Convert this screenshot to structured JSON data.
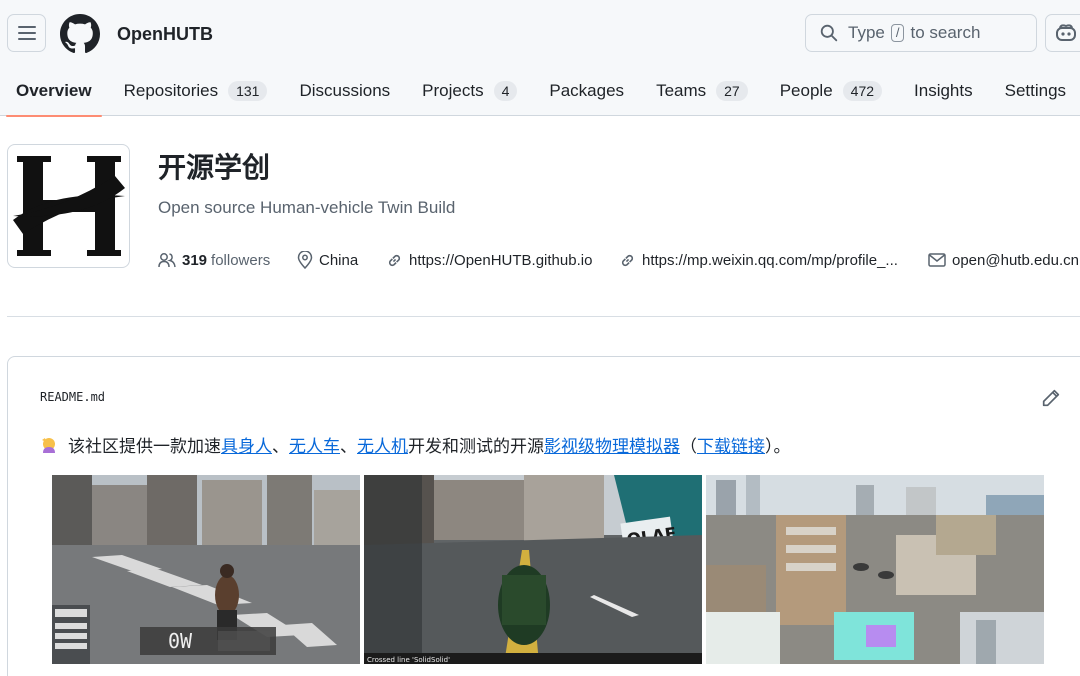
{
  "header": {
    "org_name": "OpenHUTB",
    "search": {
      "before": "Type",
      "key": "/",
      "after": "to search"
    }
  },
  "tabs": [
    {
      "label": "Overview"
    },
    {
      "label": "Repositories",
      "count": "131"
    },
    {
      "label": "Discussions"
    },
    {
      "label": "Projects",
      "count": "4"
    },
    {
      "label": "Packages"
    },
    {
      "label": "Teams",
      "count": "27"
    },
    {
      "label": "People",
      "count": "472"
    },
    {
      "label": "Insights"
    },
    {
      "label": "Settings"
    }
  ],
  "profile": {
    "title": "开源学创",
    "description": "Open source Human-vehicle Twin Build",
    "followers_count": "319",
    "followers_label": "followers",
    "location": "China",
    "website": "https://OpenHUTB.github.io",
    "wechat_link": "https://mp.weixin.qq.com/mp/profile_...",
    "email": "open@hutb.edu.cn"
  },
  "readme": {
    "filename": "README.md",
    "intro_prefix": "该社区提供一款加速",
    "link_human": "具身人",
    "sep1": "、",
    "link_car": "无人车",
    "sep2": "、",
    "link_drone": "无人机",
    "intro_middle": "开发和测试的开源",
    "link_simulator": "影视级物理模拟器",
    "paren_open": "（",
    "link_download": "下载链接",
    "paren_close": "）。"
  },
  "screenshots": {
    "shot1_hud": "0W",
    "shot2_caption": "Crossed line 'SolidSolid'",
    "shot2_sign": "OLAE"
  },
  "colors": {
    "accent_underline": "#fd8c73",
    "link": "#0969da",
    "header_bg": "#f6f8fa",
    "border": "#d0d7de"
  },
  "icons": [
    "hamburger-icon",
    "github-logo-icon",
    "search-icon",
    "copilot-icon",
    "people-icon",
    "location-icon",
    "link-icon",
    "mail-icon",
    "pencil-icon",
    "emoji-icon"
  ]
}
